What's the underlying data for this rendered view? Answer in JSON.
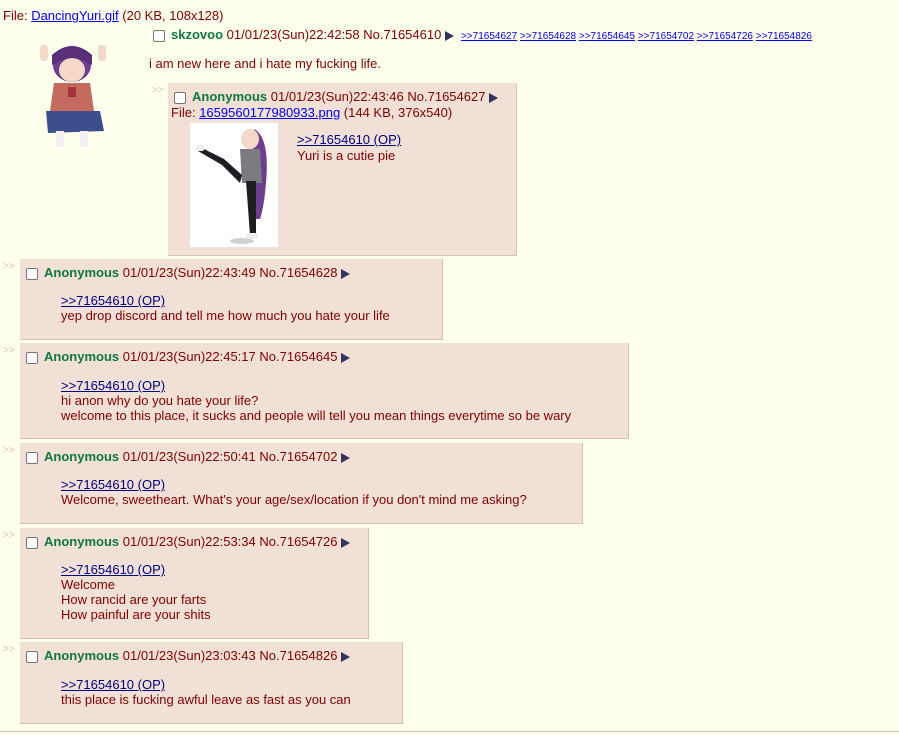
{
  "op": {
    "file_label": "File:",
    "file_name": "DancingYuri.gif",
    "file_meta": "(20 KB, 108x128)",
    "name": "skzovoo",
    "datetime": "01/01/23(Sun)22:42:58",
    "post_no": "No.71654610",
    "backlinks": [
      ">>71654627",
      ">>71654628",
      ">>71654645",
      ">>71654702",
      ">>71654726",
      ">>71654826"
    ],
    "message": "i am new here and i hate my fucking life."
  },
  "side_arrows": ">>",
  "replies": [
    {
      "name": "Anonymous",
      "datetime": "01/01/23(Sun)22:43:46",
      "post_no": "No.71654627",
      "file_label": "File:",
      "file_name": "1659560177980933.png",
      "file_meta": "(144 KB, 376x540)",
      "quote": ">>71654610 (OP)",
      "lines": [
        "Yuri is a cutie pie"
      ]
    },
    {
      "name": "Anonymous",
      "datetime": "01/01/23(Sun)22:43:49",
      "post_no": "No.71654628",
      "quote": ">>71654610 (OP)",
      "lines": [
        "yep drop discord and tell me how much you hate your life"
      ]
    },
    {
      "name": "Anonymous",
      "datetime": "01/01/23(Sun)22:45:17",
      "post_no": "No.71654645",
      "quote": ">>71654610 (OP)",
      "lines": [
        "hi anon why do you hate your life?",
        "welcome to this place, it sucks and people will tell you mean things everytime so be wary"
      ]
    },
    {
      "name": "Anonymous",
      "datetime": "01/01/23(Sun)22:50:41",
      "post_no": "No.71654702",
      "quote": ">>71654610 (OP)",
      "lines": [
        "Welcome, sweetheart. What's your age/sex/location if you don't mind me asking?"
      ]
    },
    {
      "name": "Anonymous",
      "datetime": "01/01/23(Sun)22:53:34",
      "post_no": "No.71654726",
      "quote": ">>71654610 (OP)",
      "lines": [
        "Welcome",
        "How rancid are your farts",
        "How painful are your shits"
      ]
    },
    {
      "name": "Anonymous",
      "datetime": "01/01/23(Sun)23:03:43",
      "post_no": "No.71654826",
      "quote": ">>71654610 (OP)",
      "lines": [
        "this place is fucking awful leave as fast as you can"
      ]
    }
  ],
  "colors": {
    "bg": "#FFFFEE",
    "reply_bg": "#F0E0D6",
    "name": "#117743",
    "text": "#800000",
    "link": "#0000EE",
    "quote": "#000080"
  }
}
